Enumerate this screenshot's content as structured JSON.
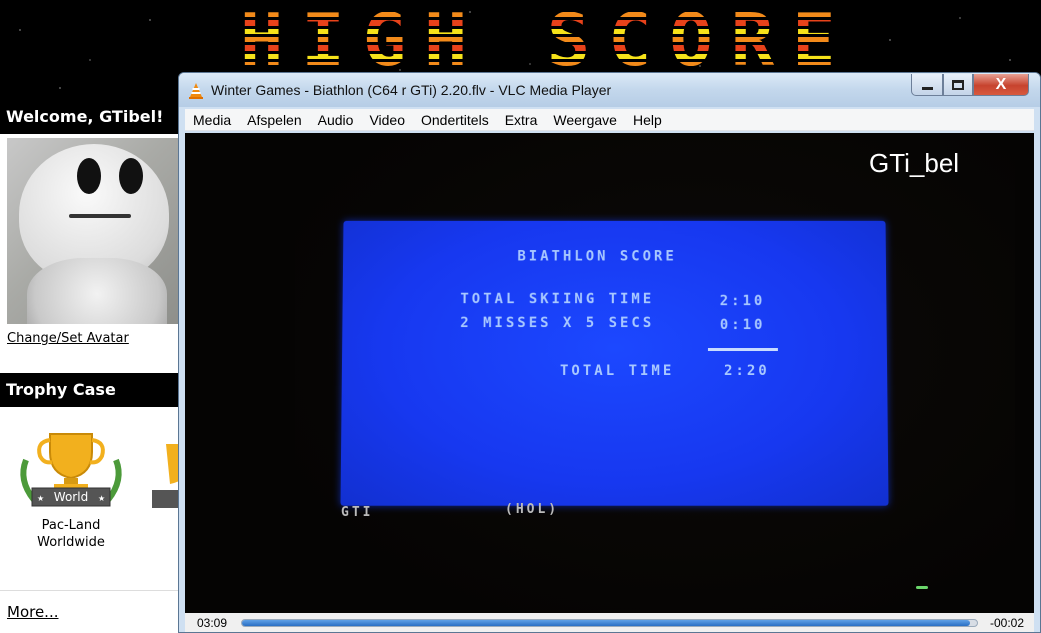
{
  "website": {
    "logo_text": "HIGH SCORE",
    "welcome": "Welcome, GTibel!",
    "avatar_link": "Change/Set Avatar",
    "trophy_case_title": "Trophy Case",
    "trophy": {
      "badge": "World",
      "caption_line1": "Pac-Land",
      "caption_line2": "Worldwide"
    },
    "more_link": "More..."
  },
  "vlc": {
    "title": "Winter Games - Biathlon (C64 r GTi) 2.20.flv - VLC Media Player",
    "window_buttons": {
      "minimize": "minimize",
      "maximize": "maximize",
      "close": "X"
    },
    "menu": [
      "Media",
      "Afspelen",
      "Audio",
      "Video",
      "Ondertitels",
      "Extra",
      "Weergave",
      "Help"
    ],
    "video": {
      "watermark": "GTi_bel",
      "screen_title": "BIATHLON SCORE",
      "row1_label": "TOTAL SKIING TIME",
      "row1_value": "2:10",
      "row2_label": "2 MISSES X 5 SECS",
      "row2_value": "0:10",
      "row3_label": "TOTAL TIME",
      "row3_value": "2:20",
      "below_left": "GTI",
      "below_right": "(HOL)"
    },
    "controls": {
      "elapsed": "03:09",
      "remaining": "-00:02",
      "progress_fraction": 0.99
    },
    "colors": {
      "c64_screen": "#1738f0",
      "c64_text": "#a8c8ff",
      "progress": "#2a6fc4",
      "close_button": "#c7432e"
    }
  }
}
